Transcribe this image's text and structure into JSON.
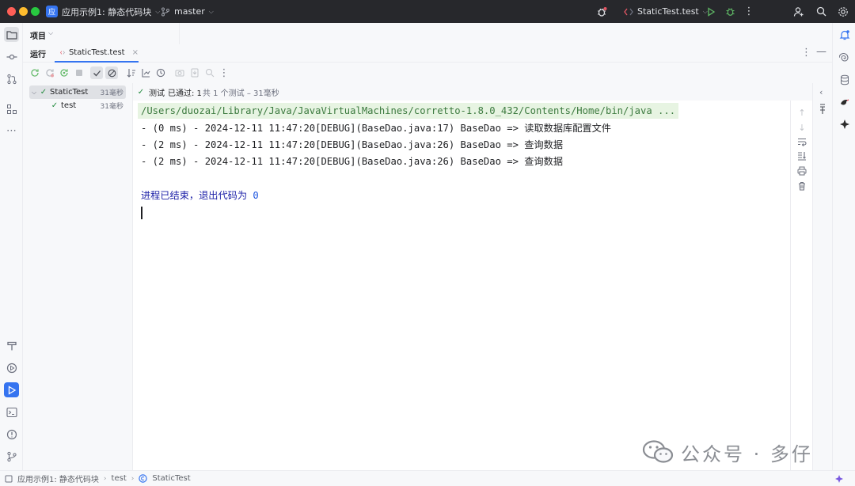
{
  "titlebar": {
    "project_badge": "应",
    "project_name": "应用示例1: 静态代码块",
    "branch": "master",
    "run_config": "StaticTest.test"
  },
  "project_panel": {
    "label": "项目"
  },
  "run_window": {
    "title": "运行",
    "tab_label": "StaticTest.test"
  },
  "test_tree": {
    "items": [
      {
        "label": "StaticTest",
        "time": "31毫秒"
      },
      {
        "label": "test",
        "time": "31毫秒"
      }
    ]
  },
  "status": {
    "prefix": "测试",
    "passed": "已通过: 1",
    "summary": "共 1 个测试 – 31毫秒"
  },
  "console": {
    "command": "/Users/duozai/Library/Java/JavaVirtualMachines/corretto-1.8.0_432/Contents/Home/bin/java ...",
    "lines": [
      "- (0 ms) - 2024-12-11 11:47:20[DEBUG](BaseDao.java:17) BaseDao => 读取数据库配置文件",
      "- (2 ms) - 2024-12-11 11:47:20[DEBUG](BaseDao.java:26) BaseDao => 查询数据",
      "- (2 ms) - 2024-12-11 11:47:20[DEBUG](BaseDao.java:26) BaseDao => 查询数据"
    ],
    "exit_text": "进程已结束，退出代码为 ",
    "exit_code": "0"
  },
  "breadcrumb": [
    "应用示例1: 静态代码块",
    "test",
    "StaticTest"
  ],
  "watermark": "公众号 · 多仔",
  "colors": {
    "accent": "#3574f0",
    "success": "#208a3c",
    "titlebar_bg": "#27282c",
    "command_bg": "#e7f4e2",
    "exit_text": "#1e22a8"
  }
}
